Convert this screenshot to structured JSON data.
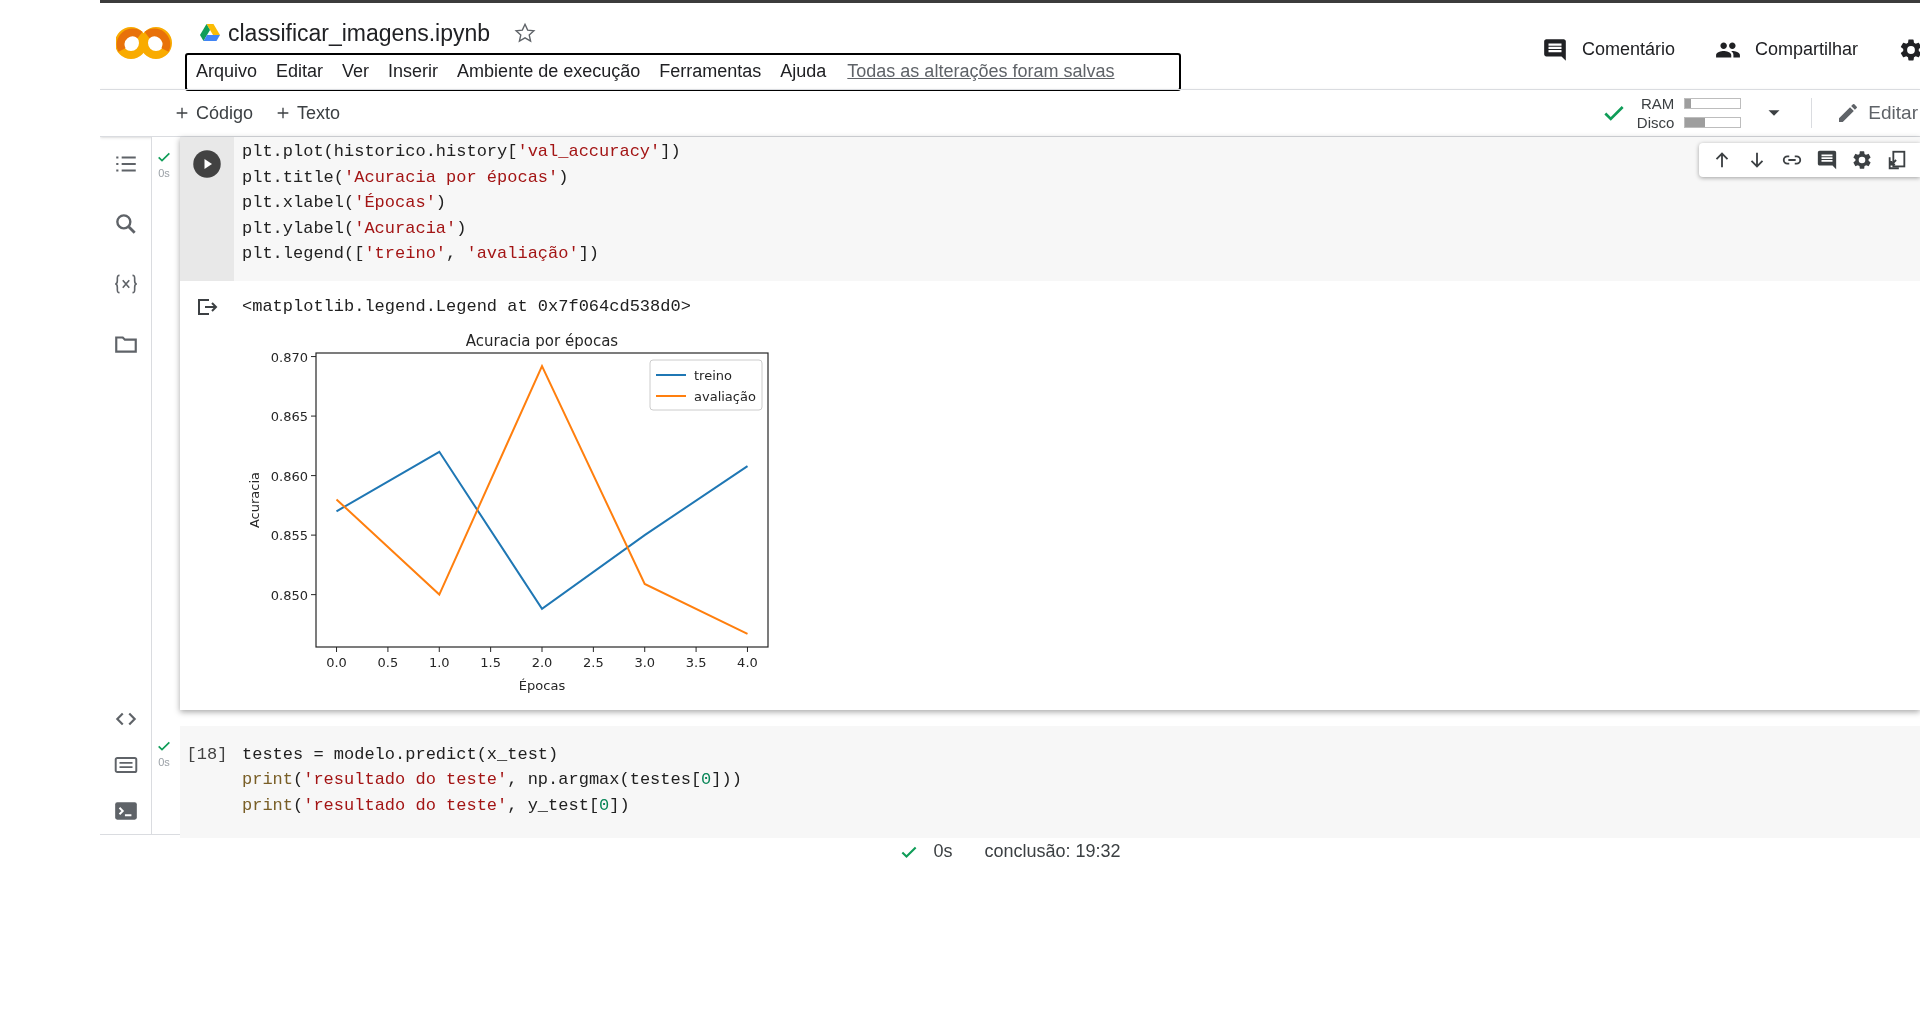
{
  "header": {
    "title": "classificar_imagens.ipynb",
    "starred": false,
    "menu": [
      "Arquivo",
      "Editar",
      "Ver",
      "Inserir",
      "Ambiente de execução",
      "Ferramentas",
      "Ajuda"
    ],
    "save_status": "Todas as alterações foram salvas",
    "actions": [
      {
        "label": "Comentário",
        "kind": "comment"
      },
      {
        "label": "Compartilhar",
        "kind": "share"
      }
    ]
  },
  "toolbar": {
    "add_buttons": [
      "Código",
      "Texto"
    ],
    "connected": true,
    "resources": [
      {
        "label": "RAM",
        "level": 0.1
      },
      {
        "label": "Disco",
        "level": 0.35
      }
    ],
    "edit_label": "Editar"
  },
  "cells": [
    {
      "selected": true,
      "ok": true,
      "duration": "0s",
      "code": [
        [
          {
            "kind": "plain",
            "s": "plt.plot(historico.history["
          },
          {
            "kind": "string",
            "s": "'val_accuracy'"
          },
          {
            "kind": "plain",
            "s": "])"
          }
        ],
        [
          {
            "kind": "plain",
            "s": "plt.title("
          },
          {
            "kind": "string",
            "s": "'Acuracia por épocas'"
          },
          {
            "kind": "plain",
            "s": ")"
          }
        ],
        [
          {
            "kind": "plain",
            "s": "plt.xlabel("
          },
          {
            "kind": "string",
            "s": "'Épocas'"
          },
          {
            "kind": "plain",
            "s": ")"
          }
        ],
        [
          {
            "kind": "plain",
            "s": "plt.ylabel("
          },
          {
            "kind": "string",
            "s": "'Acuracia'"
          },
          {
            "kind": "plain",
            "s": ")"
          }
        ],
        [
          {
            "kind": "plain",
            "s": "plt.legend(["
          },
          {
            "kind": "string",
            "s": "'treino'"
          },
          {
            "kind": "plain",
            "s": ", "
          },
          {
            "kind": "string",
            "s": "'avaliação'"
          },
          {
            "kind": "plain",
            "s": "])"
          }
        ]
      ],
      "output": {
        "text": "<matplotlib.legend.Legend at 0x7f064cd538d0>",
        "chart_data": {
          "type": "line",
          "title": "Acuracia por épocas",
          "xlabel": "Épocas",
          "ylabel": "Acuracia",
          "x": [
            0,
            1,
            2,
            3,
            4
          ],
          "series": [
            {
              "name": "treino",
              "color": "#1f77b4",
              "values": [
                0.857,
                0.862,
                0.8488,
                0.855,
                0.8608
              ]
            },
            {
              "name": "avaliação",
              "color": "#ff7f0e",
              "values": [
                0.858,
                0.85,
                0.8692,
                0.8509,
                0.8467
              ]
            }
          ],
          "legend": "upper right",
          "xlim": [
            -0.2,
            4.2
          ],
          "ylim": [
            0.8456,
            0.8703
          ],
          "xticks": [
            {
              "value": 0,
              "label": "0.0"
            },
            {
              "value": 0.5,
              "label": "0.5"
            },
            {
              "value": 1,
              "label": "1.0"
            },
            {
              "value": 1.5,
              "label": "1.5"
            },
            {
              "value": 2,
              "label": "2.0"
            },
            {
              "value": 2.5,
              "label": "2.5"
            },
            {
              "value": 3,
              "label": "3.0"
            },
            {
              "value": 3.5,
              "label": "3.5"
            },
            {
              "value": 4,
              "label": "4.0"
            }
          ],
          "yticks": [
            {
              "value": 0.85,
              "label": "0.850"
            },
            {
              "value": 0.855,
              "label": "0.855"
            },
            {
              "value": 0.86,
              "label": "0.860"
            },
            {
              "value": 0.865,
              "label": "0.865"
            },
            {
              "value": 0.87,
              "label": "0.870"
            }
          ]
        }
      }
    },
    {
      "exec_count": "[18]",
      "selected": false,
      "ok": true,
      "duration": "0s",
      "code": [
        [
          {
            "kind": "plain",
            "s": "testes = modelo.predict(x_test)"
          }
        ],
        [
          {
            "kind": "builtin",
            "s": "print"
          },
          {
            "kind": "plain",
            "s": "("
          },
          {
            "kind": "string",
            "s": "'resultado do teste'"
          },
          {
            "kind": "plain",
            "s": ", np.argmax(testes["
          },
          {
            "kind": "number",
            "s": "0"
          },
          {
            "kind": "plain",
            "s": "]))"
          }
        ],
        [
          {
            "kind": "builtin",
            "s": "print"
          },
          {
            "kind": "plain",
            "s": "("
          },
          {
            "kind": "string",
            "s": "'resultado do teste'"
          },
          {
            "kind": "plain",
            "s": ", y_test["
          },
          {
            "kind": "number",
            "s": "0"
          },
          {
            "kind": "plain",
            "s": "])"
          }
        ]
      ]
    }
  ],
  "status_bar": {
    "ok": true,
    "duration": "0s",
    "completed": "conclusão: 19:32"
  }
}
